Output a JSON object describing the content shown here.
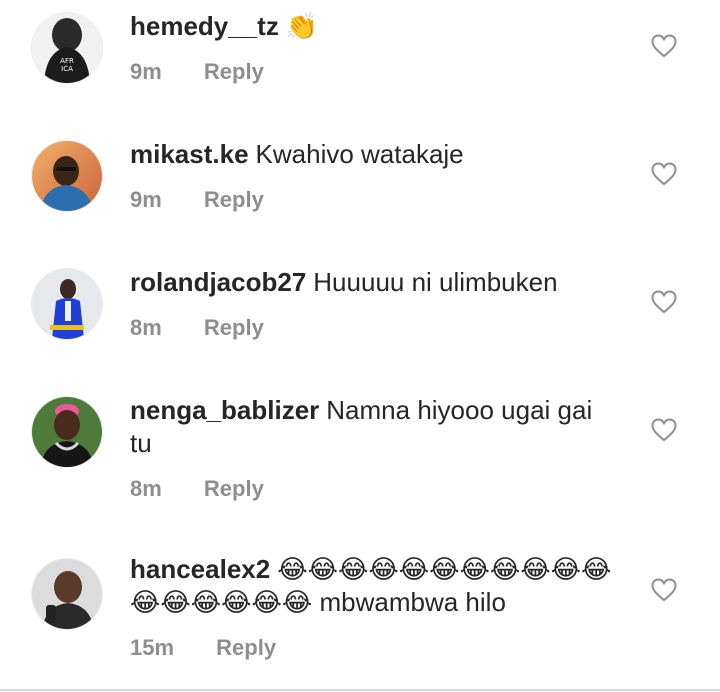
{
  "comments": [
    {
      "username": "hemedy__tz",
      "text": "👏",
      "time": "9m",
      "reply": "Reply",
      "avatar_icon": "avatar-africa-hoodie",
      "like_icon": "heart-outline-icon"
    },
    {
      "username": "mikast.ke",
      "text": "Kwahivo watakaje",
      "time": "9m",
      "reply": "Reply",
      "avatar_icon": "avatar-man-sunset",
      "like_icon": "heart-outline-icon"
    },
    {
      "username": "rolandjacob27",
      "text": "Huuuuu ni ulimbuken",
      "time": "8m",
      "reply": "Reply",
      "avatar_icon": "avatar-man-blue-suit",
      "like_icon": "heart-outline-icon"
    },
    {
      "username": "nenga_bablizer",
      "text": "Namna hiyooo ugai gai tu",
      "time": "8m",
      "reply": "Reply",
      "avatar_icon": "avatar-man-pink-hair",
      "like_icon": "heart-outline-icon"
    },
    {
      "username": "hancealex2",
      "text": "😂😂😂😂😂😂😂😂😂😂😂😂😂😂😂😂😂 mbwambwa hilo",
      "time": "15m",
      "reply": "Reply",
      "avatar_icon": "avatar-man-selfie",
      "like_icon": "heart-outline-icon"
    }
  ],
  "colors": {
    "username": "#262626",
    "text": "#262626",
    "meta": "#8e8e8e",
    "heart_stroke": "#8e8e8e",
    "divider": "#d6d6d6"
  }
}
